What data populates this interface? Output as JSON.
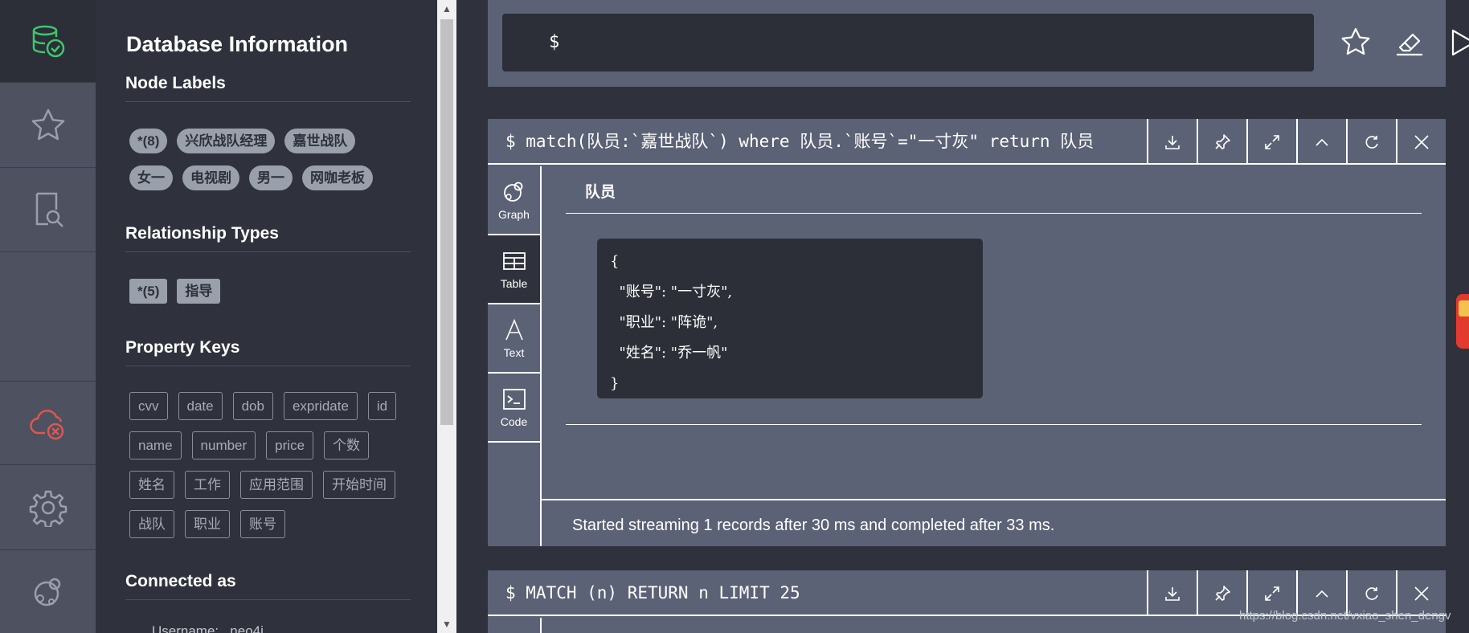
{
  "sidebar": {
    "items": [
      {
        "name": "database",
        "icon": "database-check-icon",
        "color": "#3ec76b"
      },
      {
        "name": "favorites",
        "icon": "star-icon"
      },
      {
        "name": "documents",
        "icon": "document-search-icon"
      },
      {
        "name": "empty",
        "icon": ""
      },
      {
        "name": "connection",
        "icon": "cloud-disconnected-icon",
        "color": "#e0564e"
      },
      {
        "name": "settings",
        "icon": "gear-icon"
      },
      {
        "name": "about",
        "icon": "neo4j-logo-icon"
      }
    ]
  },
  "drawer": {
    "title": "Database Information",
    "node_labels_title": "Node Labels",
    "node_labels": [
      "*(8)",
      "兴欣战队经理",
      "嘉世战队",
      "女一",
      "电视剧",
      "男一",
      "网咖老板"
    ],
    "relationship_types_title": "Relationship Types",
    "relationship_types": [
      "*(5)",
      "指导"
    ],
    "property_keys_title": "Property Keys",
    "property_keys": [
      "cvv",
      "date",
      "dob",
      "expridate",
      "id",
      "name",
      "number",
      "price",
      "个数",
      "姓名",
      "工作",
      "应用范围",
      "开始时间",
      "战队",
      "职业",
      "账号"
    ],
    "connected_as_title": "Connected as",
    "username_row": "Username:   neo4j"
  },
  "editor": {
    "prompt": "$",
    "buttons": [
      "star-icon",
      "eraser-icon",
      "play-icon"
    ]
  },
  "frames": [
    {
      "query": "$ match(队员:`嘉世战队`) where 队员.`账号`=\"一寸灰\" return 队员",
      "actions": [
        "download-icon",
        "pin-icon",
        "expand-icon",
        "collapse-icon",
        "rerun-icon",
        "close-icon"
      ],
      "tabs": [
        "Graph",
        "Table",
        "Text",
        "Code"
      ],
      "column_header": "队员",
      "record_lines": [
        "{",
        "  \"账号\": \"一寸灰\",",
        "  \"职业\": \"阵诡\",",
        "  \"姓名\": \"乔一帆\"",
        "}"
      ],
      "status": "Started streaming 1 records after 30 ms and completed after 33 ms."
    },
    {
      "query": "$ MATCH (n) RETURN n LIMIT 25",
      "actions": [
        "download-icon",
        "pin-icon",
        "expand-icon",
        "collapse-icon",
        "rerun-icon",
        "close-icon"
      ]
    }
  ],
  "scrollbar": {
    "up": "▲",
    "down": "▼"
  },
  "watermark": "https://blog.csdn.net/vxiao_shen_dengv"
}
